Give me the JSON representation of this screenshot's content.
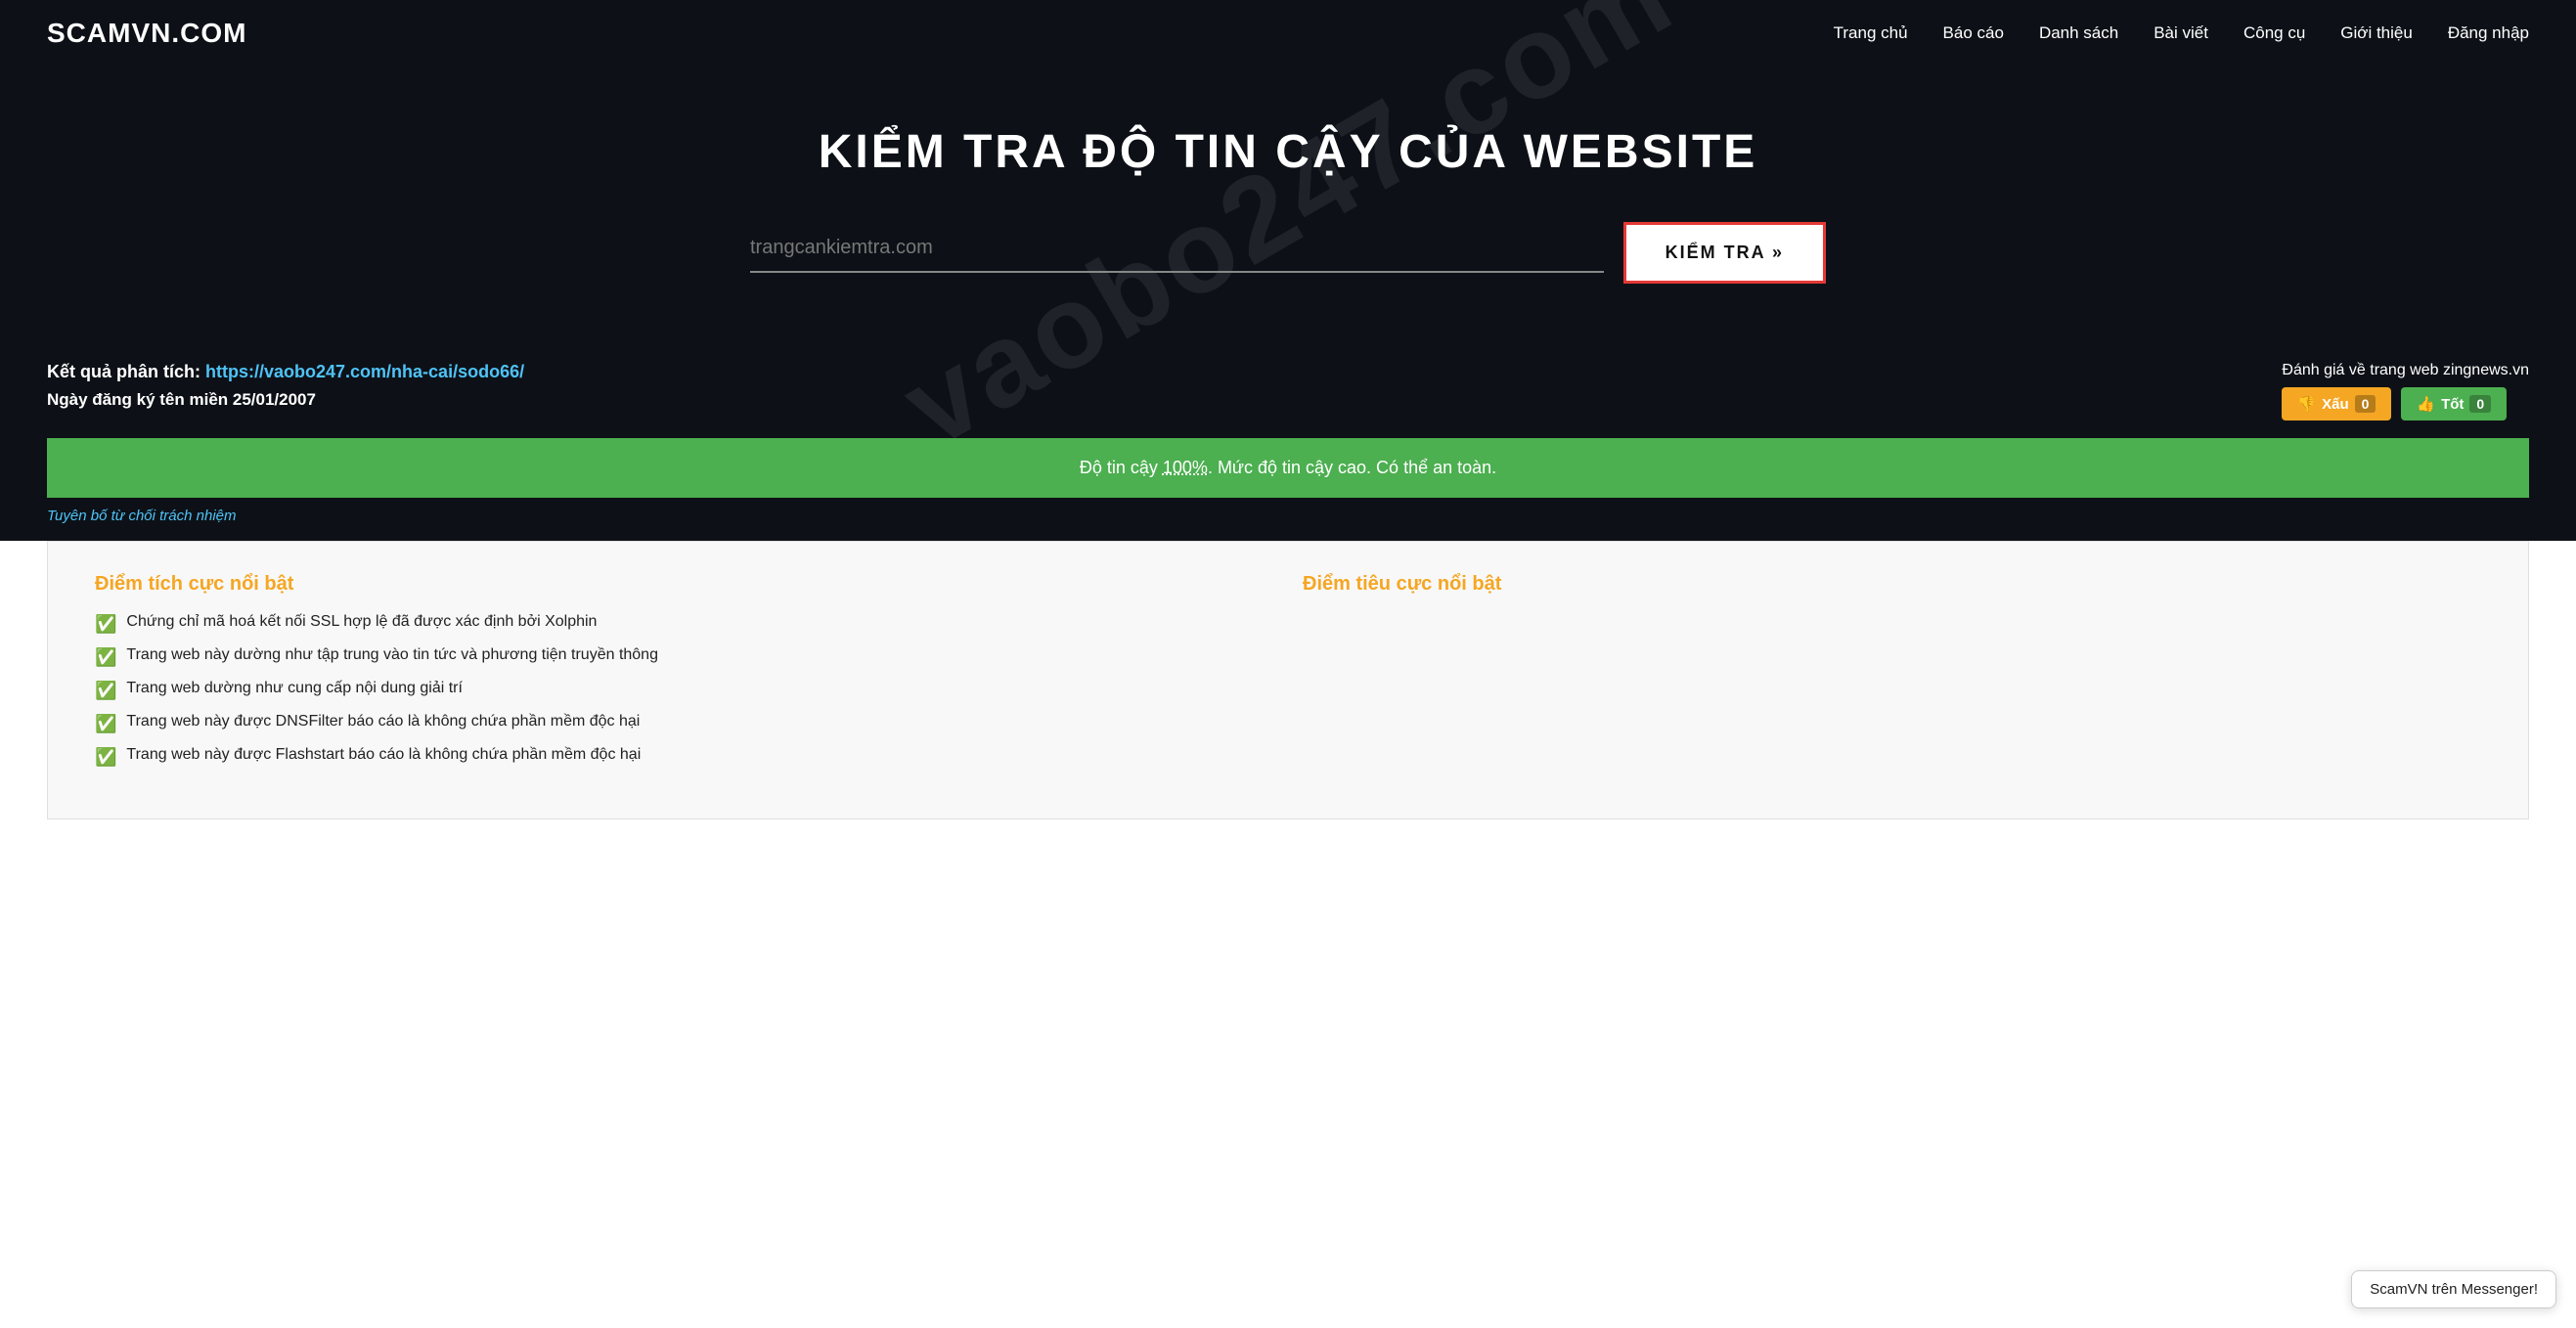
{
  "header": {
    "logo": "SCAMVN.COM",
    "nav": [
      {
        "label": "Trang chủ",
        "href": "#"
      },
      {
        "label": "Báo cáo",
        "href": "#"
      },
      {
        "label": "Danh sách",
        "href": "#"
      },
      {
        "label": "Bài viết",
        "href": "#"
      },
      {
        "label": "Công cụ",
        "href": "#"
      },
      {
        "label": "Giới thiệu",
        "href": "#"
      },
      {
        "label": "Đăng nhập",
        "href": "#"
      }
    ]
  },
  "hero": {
    "title": "KIỂM TRA ĐỘ TIN CẬY CỦA WEBSITE",
    "input_placeholder": "trangcankiemtra.com",
    "button_label": "KIỂM TRA »",
    "watermark": "vaobo247.com"
  },
  "result": {
    "label": "Kết quả phân tích:",
    "link_text": "https://vaobo247.com/nha-cai/sodo66/",
    "link_href": "https://vaobo247.com/nha-cai/sodo66/",
    "date_label": "Ngày đăng ký tên miền 25/01/2007",
    "review_label": "Đánh giá về trang web zingnews.vn",
    "vote_bad_label": "👎 Xấu",
    "vote_bad_count": "0",
    "vote_good_label": "👍 Tốt",
    "vote_good_count": "0"
  },
  "trust_bar": {
    "text_prefix": "Độ tin cậy ",
    "percent": "100%",
    "text_suffix": ". Mức độ tin cậy cao. Có thể an toàn."
  },
  "disclaimer": {
    "link_text": "Tuyên bố từ chối trách nhiệm"
  },
  "analysis": {
    "positive_title": "Điểm tích cực nổi bật",
    "negative_title": "Điểm tiêu cực nổi bật",
    "positive_items": [
      "Chứng chỉ mã hoá kết nối SSL hợp lệ đã được xác định bởi Xolphin",
      "Trang web này dường như tập trung vào tin tức và phương tiện truyền thông",
      "Trang web dường như cung cấp nội dung giải trí",
      "Trang web này được DNSFilter báo cáo là không chứa phần mềm độc hại",
      "Trang web này được Flashstart báo cáo là không chứa phần mềm độc hại"
    ],
    "negative_items": []
  },
  "messenger_badge": {
    "text": "ScamVN trên Messenger!"
  }
}
